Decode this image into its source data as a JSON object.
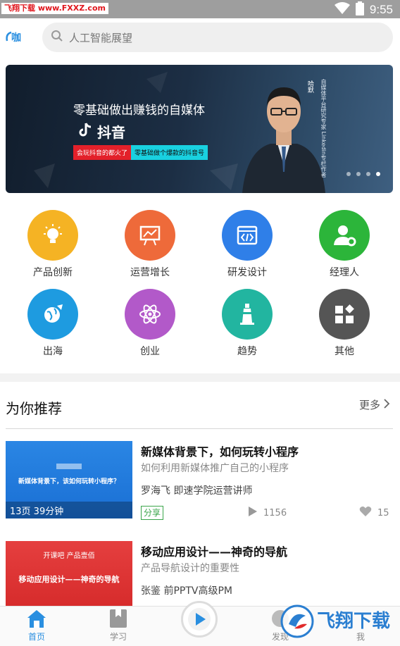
{
  "statusbar": {
    "watermark": "飞翔下载 www.FXXZ.com",
    "time": "9:55"
  },
  "header": {
    "logo": "i咖",
    "search_placeholder": "人工智能展望"
  },
  "banner": {
    "title": "零基础做出赚钱的自媒体",
    "brand": "抖音",
    "tag1": "会玩抖音的都火了",
    "tag2": "零基础做个爆款的抖音号",
    "name": "哈默",
    "vertical_text": "自媒体平台研究专家 Linkedin专栏作者",
    "dots": 4,
    "active_dot": 4
  },
  "categories": [
    {
      "label": "产品创新",
      "icon": "lightbulb-icon",
      "color": "#f5b324"
    },
    {
      "label": "运营增长",
      "icon": "chart-board-icon",
      "color": "#ee6a3a"
    },
    {
      "label": "研发设计",
      "icon": "code-window-icon",
      "color": "#2f7fe8"
    },
    {
      "label": "经理人",
      "icon": "manager-icon",
      "color": "#2cb53a"
    },
    {
      "label": "出海",
      "icon": "globe-plane-icon",
      "color": "#1e9be0"
    },
    {
      "label": "创业",
      "icon": "atom-icon",
      "color": "#b259c9"
    },
    {
      "label": "趋势",
      "icon": "lighthouse-icon",
      "color": "#22b5a0"
    },
    {
      "label": "其他",
      "icon": "apps-icon",
      "color": "#555555"
    }
  ],
  "recommend": {
    "title": "为你推荐",
    "more": "更多",
    "items": [
      {
        "thumb_title": "新媒体背景下，该如何玩转小程序？",
        "thumb_meta": "13页  39分钟",
        "title": "新媒体背景下，如何玩转小程序",
        "subtitle": "如何利用新媒体推广自己的小程序",
        "author": "罗海飞  即速学院运营讲师",
        "tag": "分享",
        "plays": "1156",
        "likes": "15"
      },
      {
        "thumb_brand": "开课吧  产品壹佰",
        "thumb_title": "移动应用设计——神奇的导航",
        "title": "移动应用设计——神奇的导航",
        "subtitle": "产品导航设计的重要性",
        "author": "张鉴  前PPTV高级PM"
      }
    ]
  },
  "nav": {
    "home": "首页",
    "learn": "学习",
    "discover": "发现",
    "me": "我"
  },
  "watermark_logo": "飞翔下载"
}
